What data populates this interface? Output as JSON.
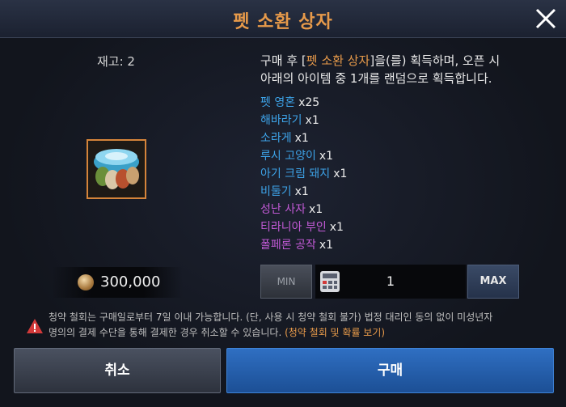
{
  "dialog": {
    "title": "펫 소환 상자",
    "close_icon": "close-icon"
  },
  "item": {
    "stock_label": "재고: 2",
    "icon": "pet-summon-box-icon",
    "price_icon": "coin-icon",
    "price": "300,000"
  },
  "description": {
    "part1": "구매 후 [",
    "item_name": "펫 소환 상자",
    "part2": "]을(를) 획득하며, 오픈 시",
    "line2": "아래의 아이템 중 1개를 랜덤으로 획득합니다."
  },
  "rewards": [
    {
      "name": "펫 영혼",
      "qty": "x25",
      "color": "#3da3e8"
    },
    {
      "name": "해바라기",
      "qty": "x1",
      "color": "#3da3e8"
    },
    {
      "name": "소라게",
      "qty": "x1",
      "color": "#3da3e8"
    },
    {
      "name": "루시 고양이",
      "qty": "x1",
      "color": "#3da3e8"
    },
    {
      "name": "아기 크림 돼지",
      "qty": "x1",
      "color": "#3da3e8"
    },
    {
      "name": "비둘기",
      "qty": "x1",
      "color": "#3da3e8"
    },
    {
      "name": "성난 사자",
      "qty": "x1",
      "color": "#c25ad6"
    },
    {
      "name": "티라니아 부인",
      "qty": "x1",
      "color": "#c25ad6"
    },
    {
      "name": "폴페론 공작",
      "qty": "x1",
      "color": "#c25ad6"
    }
  ],
  "quantity": {
    "min_label": "MIN",
    "max_label": "MAX",
    "value": "1",
    "calc_icon": "calculator-icon"
  },
  "notice": {
    "warn_icon": "warning-icon",
    "line1": "청약 철회는 구매일로부터 7일 이내 가능합니다. (단, 사용 시 청약 철회 불가) 법정 대리인 동의 없이 미성년자",
    "line2": "명의의 결제 수단을 통해 결제한 경우 취소할 수 있습니다. ",
    "link": "(청약 철회 및 확률 보기)"
  },
  "buttons": {
    "cancel": "취소",
    "buy": "구매"
  },
  "colors": {
    "accent": "#e79a4a",
    "buy_button": "#2f6fc2",
    "rare": "#3da3e8",
    "epic": "#c25ad6"
  }
}
